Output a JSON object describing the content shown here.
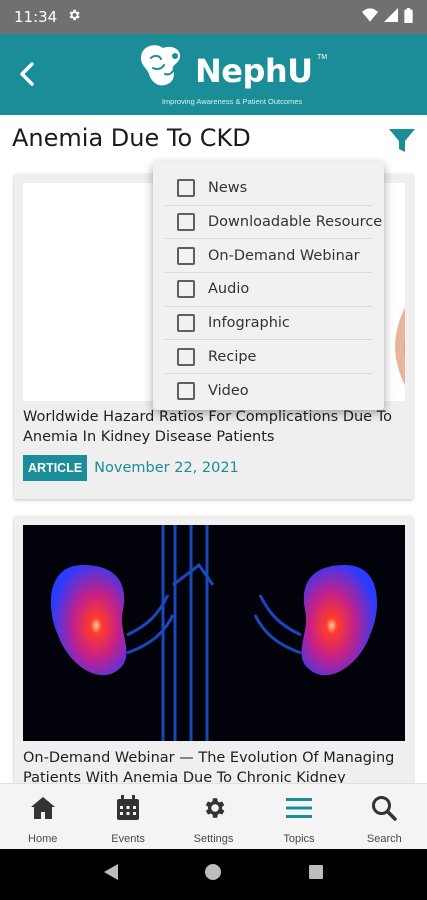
{
  "status_bar": {
    "time": "11:34"
  },
  "header": {
    "logo_text": "NephU",
    "logo_tm": "TM",
    "tagline": "Improving Awareness & Patient Outcomes"
  },
  "page": {
    "title": "Anemia Due To CKD"
  },
  "filter_menu": {
    "items": [
      {
        "label": "News",
        "checked": false
      },
      {
        "label": "Downloadable Resource",
        "checked": false
      },
      {
        "label": "On-Demand Webinar",
        "checked": false
      },
      {
        "label": "Audio",
        "checked": false
      },
      {
        "label": "Infographic",
        "checked": false
      },
      {
        "label": "Recipe",
        "checked": false
      },
      {
        "label": "Video",
        "checked": false
      }
    ]
  },
  "cards": [
    {
      "title": "Worldwide Hazard Ratios For Complications Due To Anemia In Kidney Disease Patients",
      "badge": "ARTICLE",
      "date": "November 22, 2021"
    },
    {
      "title": "On-Demand Webinar — The Evolution Of Managing Patients With Anemia Due To Chronic Kidney"
    }
  ],
  "bottom_nav": {
    "items": [
      {
        "label": "Home",
        "icon": "home-icon"
      },
      {
        "label": "Events",
        "icon": "calendar-icon"
      },
      {
        "label": "Settings",
        "icon": "gear-icon"
      },
      {
        "label": "Topics",
        "icon": "menu-icon"
      },
      {
        "label": "Search",
        "icon": "search-icon"
      }
    ]
  },
  "colors": {
    "brand": "#1a8d98",
    "status_bar": "#707070",
    "nav_bg": "#f4f4f4"
  }
}
